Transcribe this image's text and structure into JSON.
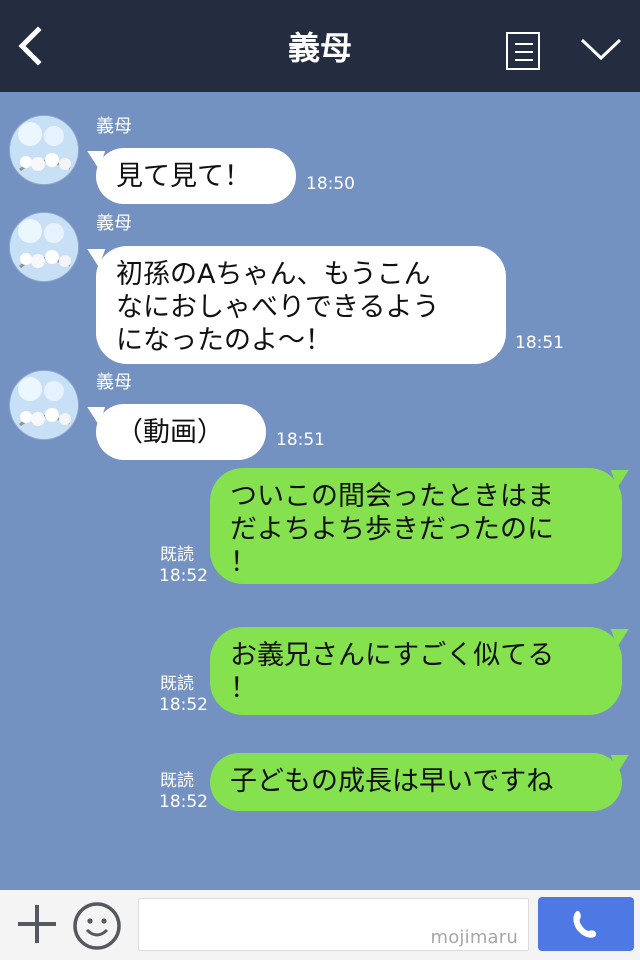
{
  "header": {
    "title": "義母"
  },
  "messages": [
    {
      "sender": "義母",
      "text": "見て見て！",
      "time": "18:50"
    },
    {
      "sender": "義母",
      "lines": [
        "初孫のAちゃん、もうこん",
        "なにおしゃべりできるよう",
        "になったのよ〜！"
      ],
      "time": "18:51"
    },
    {
      "sender": "義母",
      "text": "（動画）",
      "time": "18:51"
    },
    {
      "lines": [
        "ついこの間会ったときはま",
        "だよちよち歩きだったのに",
        "！"
      ],
      "read": "既読",
      "time": "18:52"
    },
    {
      "lines": [
        "お義兄さんにすごく似てる",
        "！"
      ],
      "read": "既読",
      "time": "18:52"
    },
    {
      "text": "子どもの成長は早いですね",
      "read": "既読",
      "time": "18:52"
    }
  ],
  "composer": {
    "watermark": "mojimaru"
  },
  "colors": {
    "header": "#242d40",
    "background": "#7492c1",
    "incoming": "#ffffff",
    "outgoing": "#85e14e",
    "send": "#4e79e4"
  },
  "icons": [
    "back-chevron-icon",
    "menu-list-icon",
    "dropdown-chevron-icon",
    "add-icon",
    "emoji-icon",
    "phone-icon"
  ]
}
